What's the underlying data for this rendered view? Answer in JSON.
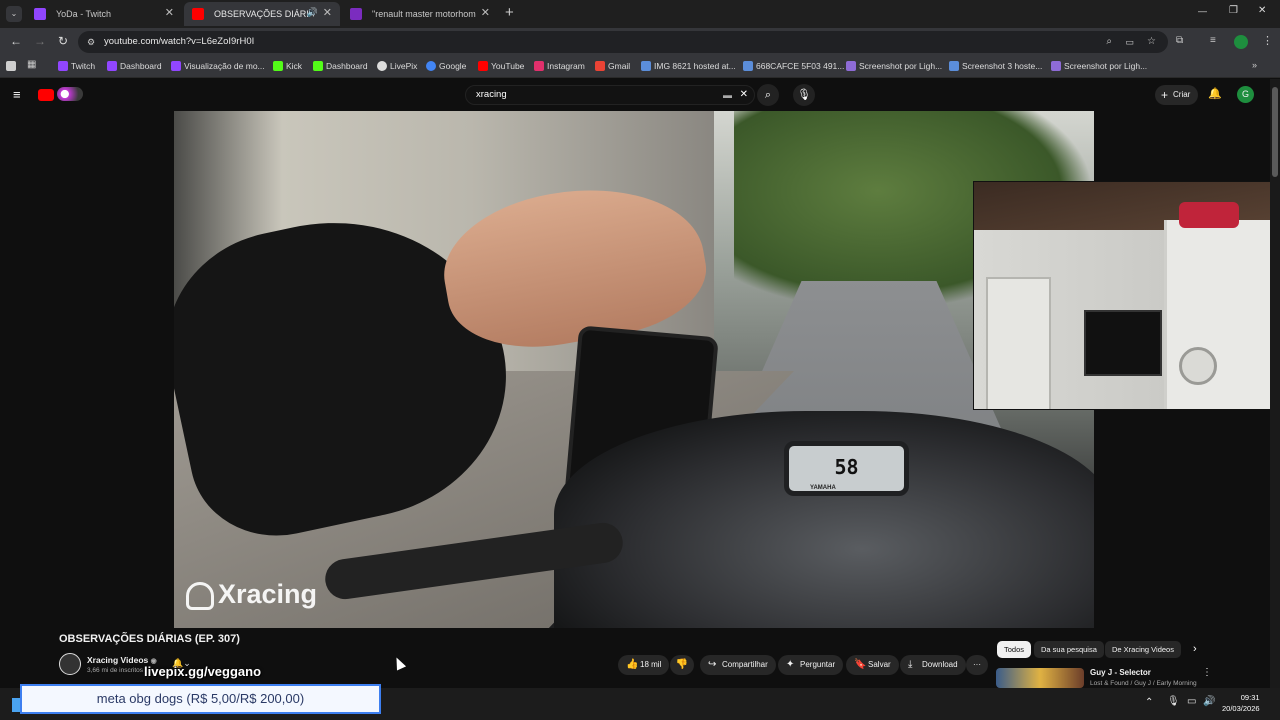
{
  "tabs": [
    {
      "label": "YoDa - Twitch",
      "icon": "twitch-icon",
      "color": "#9146ff"
    },
    {
      "label": "OBSERVAÇÕES DIÁRIAS (EP",
      "icon": "youtube-icon",
      "color": "#ff0000"
    },
    {
      "label": "\"renault master motorhome\" -",
      "icon": "search-results-icon",
      "color": "#7b2cbf"
    }
  ],
  "new_tab": "+",
  "window_controls": {
    "minimize": "—",
    "restore": "❐",
    "close": "✕"
  },
  "address": {
    "url": "youtube.com/watch?v=L6eZoI9rH0I"
  },
  "bookmarks": [
    {
      "label": "Twitch",
      "color": "#9146ff"
    },
    {
      "label": "Dashboard",
      "color": "#9146ff"
    },
    {
      "label": "Visualização de mo...",
      "color": "#9146ff"
    },
    {
      "label": "Kick",
      "color": "#53fc18"
    },
    {
      "label": "Dashboard",
      "color": "#53fc18"
    },
    {
      "label": "LivePix",
      "color": "#dddddd"
    },
    {
      "label": "Google",
      "color": "#4285f4"
    },
    {
      "label": "YouTube",
      "color": "#ff0000"
    },
    {
      "label": "Instagram",
      "color": "#e1306c"
    },
    {
      "label": "Gmail",
      "color": "#ea4335"
    },
    {
      "label": "IMG 8621 hosted at...",
      "color": "#5b8dd9"
    },
    {
      "label": "668CAFCE 5F03 491...",
      "color": "#5b8dd9"
    },
    {
      "label": "Screenshot por Ligh...",
      "color": "#8e6bd6"
    },
    {
      "label": "Screenshot 3 hoste...",
      "color": "#5b8dd9"
    },
    {
      "label": "Screenshot por Ligh...",
      "color": "#8e6bd6"
    }
  ],
  "youtube": {
    "search_value": "xracing",
    "create_label": "Criar",
    "avatar_letter": "G"
  },
  "video": {
    "speed": "58",
    "brand": "YAMAHA",
    "watermark": "Xracing"
  },
  "meta": {
    "title": "OBSERVAÇÕES DIÁRIAS (EP. 307)",
    "channel": "Xracing Videos",
    "subscribers": "3,66 mi de inscritos",
    "overlay_link": "livepix.gg/veggano",
    "likes": "18 mil",
    "share": "Compartilhar",
    "ask": "Perguntar",
    "save": "Salvar",
    "download": "Download",
    "more": "···"
  },
  "chips": [
    "Todos",
    "Da sua pesquisa",
    "De Xracing Videos"
  ],
  "recommended": {
    "title": "Guy J - Selector",
    "subtitle": "Lost & Found / Guy J / Early Morning"
  },
  "goal_bar": "meta obg dogs (R$ 5,00/R$ 200,00)",
  "clock": {
    "time": "09:31",
    "date": "20/03/2026"
  }
}
